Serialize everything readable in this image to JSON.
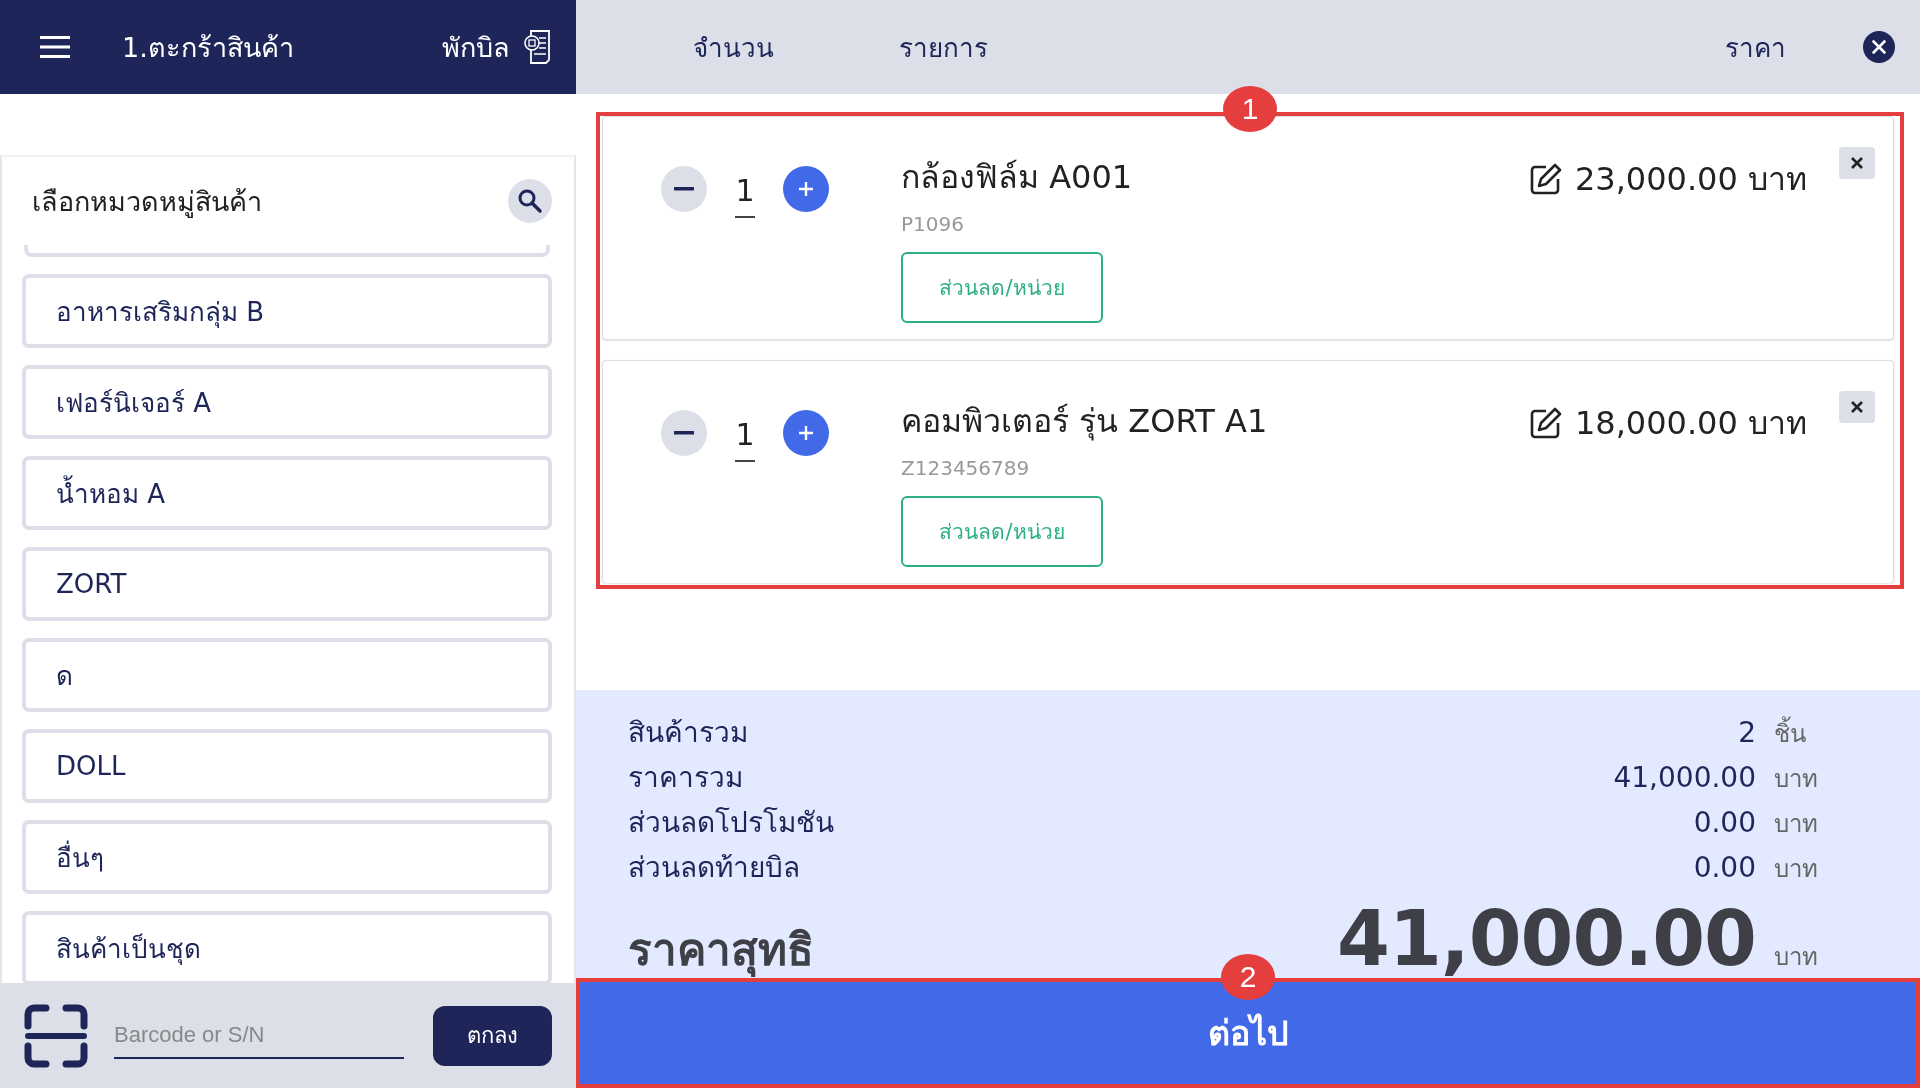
{
  "header": {
    "title": "1.ตะกร้าสินค้า",
    "hold_label": "พักบิล"
  },
  "category_panel": {
    "title": "เลือกหมวดหมู่สินค้า",
    "categories": [
      {
        "label": "อาหารเสริมกลุ่ม B"
      },
      {
        "label": "เฟอร์นิเจอร์ A"
      },
      {
        "label": "น้ำหอม A"
      },
      {
        "label": "ZORT"
      },
      {
        "label": "ด"
      },
      {
        "label": "DOLL"
      },
      {
        "label": "อื่นๆ"
      },
      {
        "label": "สินค้าเป็นชุด"
      }
    ]
  },
  "scan_bar": {
    "placeholder": "Barcode or S/N",
    "button": "ตกลง"
  },
  "cart_header": {
    "columns": [
      "จำนวน",
      "รายการ",
      "ราคา"
    ]
  },
  "cart_items": [
    {
      "quantity": "1",
      "name": "กล้องฟิล์ม A001",
      "code": "P1096",
      "price": "23,000.00 บาท",
      "discount_button": "ส่วนลด/หน่วย"
    },
    {
      "quantity": "1",
      "name": "คอมพิวเตอร์ รุ่น ZORT A1",
      "code": "Z123456789",
      "price": "18,000.00 บาท",
      "discount_button": "ส่วนลด/หน่วย"
    }
  ],
  "summary": {
    "rows": [
      {
        "label": "สินค้ารวม",
        "value": "2",
        "unit": "ชิ้น"
      },
      {
        "label": "ราคารวม",
        "value": "41,000.00",
        "unit": "บาท"
      },
      {
        "label": "ส่วนลดโปรโมชัน",
        "value": "0.00",
        "unit": "บาท"
      },
      {
        "label": "ส่วนลดท้ายบิล",
        "value": "0.00",
        "unit": "บาท"
      }
    ],
    "net": {
      "label": "ราคาสุทธิ",
      "value": "41,000.00",
      "unit": "บาท"
    }
  },
  "next_button": "ต่อไป",
  "annotations": [
    {
      "label": "1"
    },
    {
      "label": "2"
    }
  ]
}
